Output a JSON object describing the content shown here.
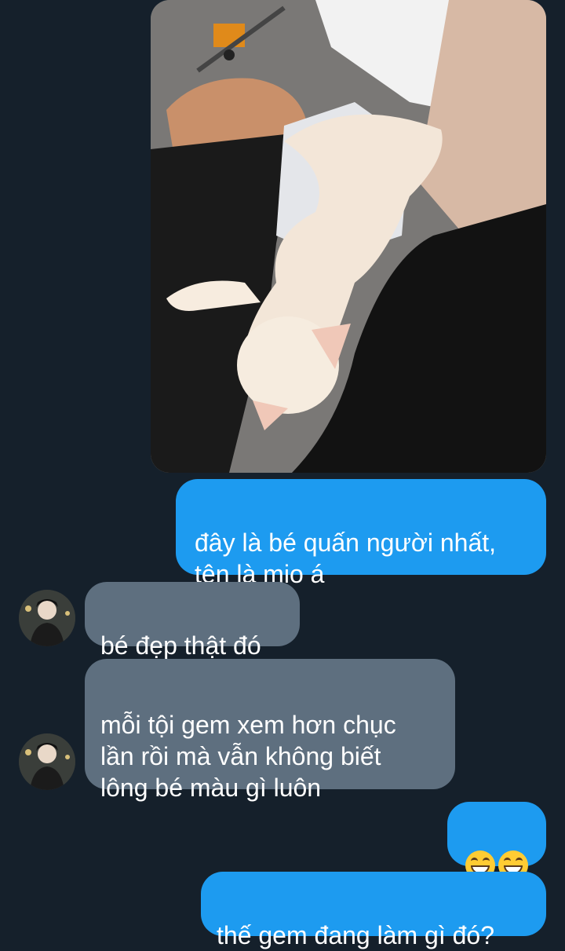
{
  "chat": {
    "messages": [
      {
        "sender": "self",
        "type": "image",
        "image_icon": "photo-cat-sleeping"
      },
      {
        "sender": "self",
        "type": "text",
        "text": "đây là bé quấn người nhất,\ntên là mio á"
      },
      {
        "sender": "other",
        "type": "text",
        "text": "bé đẹp thật đó"
      },
      {
        "sender": "other",
        "type": "text",
        "text": "mỗi tội gem xem hơn chục\nlần rồi mà vẫn không biết\nlông bé màu gì luôn"
      },
      {
        "sender": "self",
        "type": "emoji",
        "emojis": [
          "grinning-face-smiling-eyes",
          "grinning-face-smiling-eyes"
        ]
      },
      {
        "sender": "self",
        "type": "text",
        "text": "thế gem đang làm gì đó?"
      }
    ]
  },
  "colors": {
    "background": "#15202b",
    "outgoing_bubble": "#1d9bf0",
    "incoming_bubble": "#5e6f7f",
    "text": "#ffffff"
  }
}
